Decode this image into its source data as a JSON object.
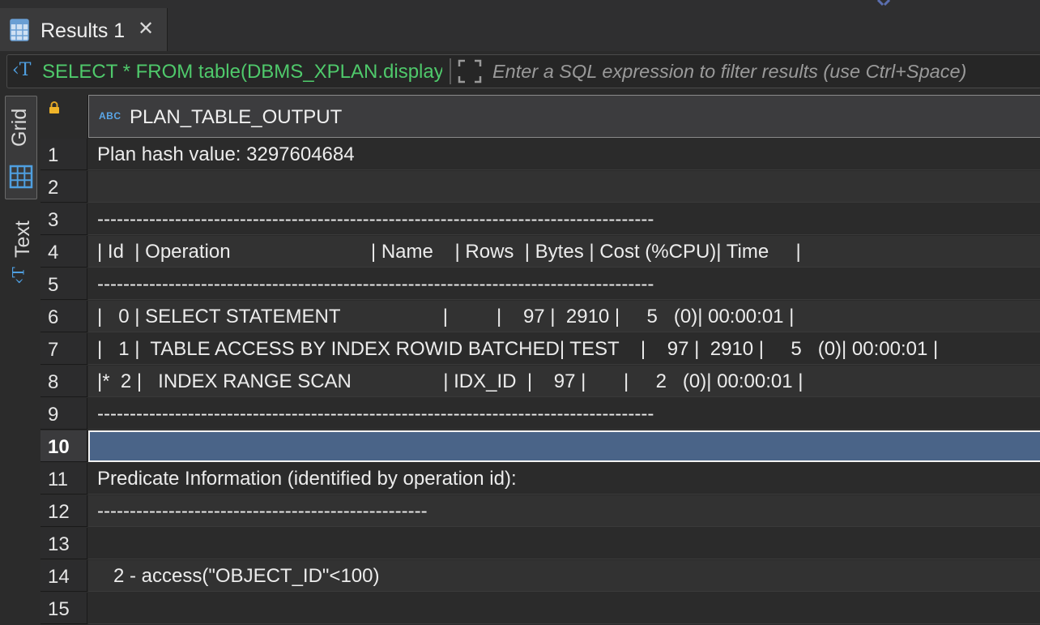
{
  "tab": {
    "label": "Results 1",
    "close": "✕"
  },
  "filter": {
    "sql": "SELECT * FROM table(DBMS_XPLAN.display)",
    "placeholder": "Enter a SQL expression to filter results (use Ctrl+Space)"
  },
  "side_tabs": {
    "grid": "Grid",
    "text": "Text"
  },
  "column": {
    "type_badge": "ABC",
    "name": "PLAN_TABLE_OUTPUT"
  },
  "selected_row": 10,
  "rows": [
    {
      "num": "1",
      "value": "Plan hash value: 3297604684"
    },
    {
      "num": "2",
      "value": ""
    },
    {
      "num": "3",
      "value": "--------------------------------------------------------------------------------------"
    },
    {
      "num": "4",
      "value": "| Id  | Operation                          | Name    | Rows  | Bytes | Cost (%CPU)| Time     |"
    },
    {
      "num": "5",
      "value": "--------------------------------------------------------------------------------------"
    },
    {
      "num": "6",
      "value": "|   0 | SELECT STATEMENT                   |         |    97 |  2910 |     5   (0)| 00:00:01 |"
    },
    {
      "num": "7",
      "value": "|   1 |  TABLE ACCESS BY INDEX ROWID BATCHED| TEST    |    97 |  2910 |     5   (0)| 00:00:01 |"
    },
    {
      "num": "8",
      "value": "|*  2 |   INDEX RANGE SCAN                 | IDX_ID  |    97 |       |     2   (0)| 00:00:01 |"
    },
    {
      "num": "9",
      "value": "--------------------------------------------------------------------------------------"
    },
    {
      "num": "10",
      "value": ""
    },
    {
      "num": "11",
      "value": "Predicate Information (identified by operation id):"
    },
    {
      "num": "12",
      "value": "---------------------------------------------------"
    },
    {
      "num": "13",
      "value": ""
    },
    {
      "num": "14",
      "value": "   2 - access(\"OBJECT_ID\"<100)"
    },
    {
      "num": "15",
      "value": ""
    }
  ],
  "colors": {
    "selection": "#4a6488",
    "sql_text": "#4fc96b",
    "accent": "#4f9fe0"
  }
}
